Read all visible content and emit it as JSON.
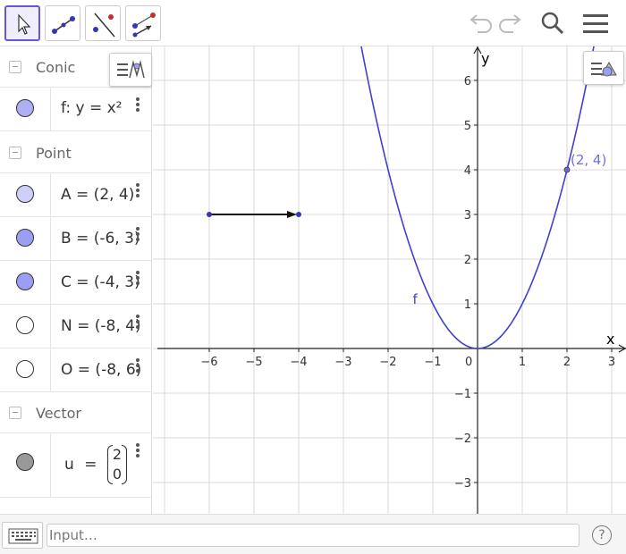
{
  "toolbar": {
    "tools": [
      "move-tool",
      "vector-tool",
      "line-tool",
      "vector-from-point-tool"
    ],
    "undo": "undo",
    "redo": "redo",
    "search": "search",
    "menu": "menu"
  },
  "algebra": {
    "categories": {
      "conic": "Conic",
      "point": "Point",
      "vector": "Vector"
    },
    "items": {
      "f": "f: y = x²",
      "A": "A = (2, 4)",
      "B": "B = (-6, 3)",
      "C": "C = (-4, 3)",
      "N": "N = (-8, 4)",
      "O": "O = (-8, 6)",
      "u_lhs": "u",
      "u_eq": "=",
      "u_top": "2",
      "u_bot": "0"
    },
    "colors": {
      "f": "#aeb0f5",
      "A": "#cfd0fa",
      "B": "#9c9ef5",
      "C": "#9c9ef5",
      "N": "#ffffff",
      "O": "#ffffff",
      "u": "#999999"
    }
  },
  "graphics": {
    "x_axis_label": "x",
    "y_axis_label": "y",
    "x_ticks": [
      "−6",
      "−5",
      "−4",
      "−3",
      "−2",
      "−1",
      "0",
      "1",
      "2",
      "3"
    ],
    "y_ticks": [
      "6",
      "5",
      "4",
      "3",
      "2",
      "1",
      "−1",
      "−2",
      "−3"
    ],
    "curve_label": "f",
    "point_label": "(2, 4)",
    "curve_color": "#4040d0",
    "point_label_color": "#7070e0"
  },
  "input": {
    "placeholder": "Input…",
    "help": "?"
  }
}
